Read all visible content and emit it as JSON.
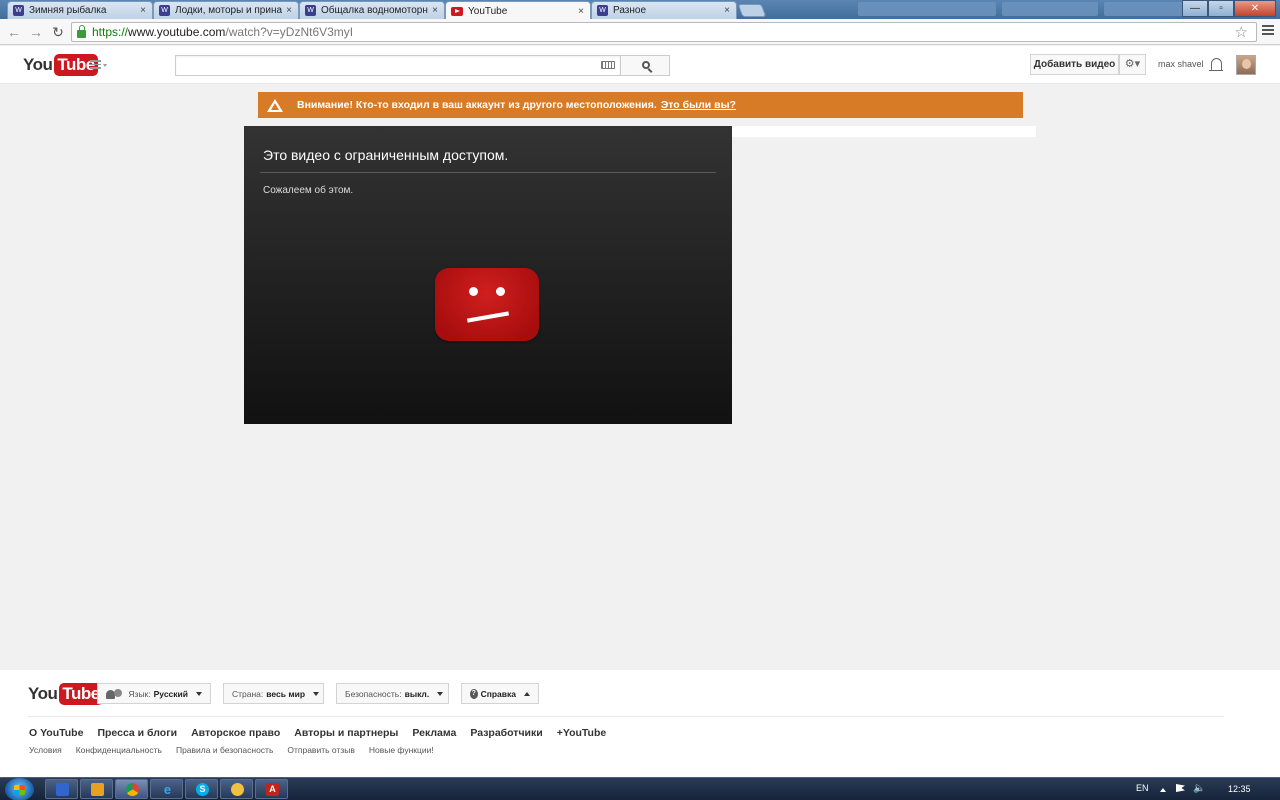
{
  "browser": {
    "tabs": [
      {
        "title": "Зимняя рыбалка",
        "favicon": "forum-icon",
        "active": false
      },
      {
        "title": "Лодки, моторы и принад",
        "favicon": "forum-icon",
        "active": false
      },
      {
        "title": "Общалка водномоторни",
        "favicon": "forum-icon",
        "active": false
      },
      {
        "title": "YouTube",
        "favicon": "youtube-icon",
        "active": true
      },
      {
        "title": "Разное",
        "favicon": "forum-icon",
        "active": false
      }
    ],
    "tab_close_glyph": "×",
    "url": {
      "scheme": "https://",
      "host": "www.youtube.com",
      "path": "/watch?v=yDzNt6V3myI"
    }
  },
  "masthead": {
    "logo_you": "You",
    "logo_tube": "Tube",
    "search_value": "",
    "upload_label": "Добавить видео",
    "settings_glyph": "⚙▾",
    "username": "max shavel"
  },
  "alert": {
    "message": "Внимание! Кто-то входил в ваш аккаунт из другого местоположения.",
    "link": "Это были вы?",
    "color": "#d77b26"
  },
  "player": {
    "title": "Это видео с ограниченным доступом.",
    "subtitle": "Сожалеем об этом.",
    "icon": "sad-youtube-icon",
    "icon_color": "#cc181e"
  },
  "footer": {
    "logo_you": "You",
    "logo_tube": "Tube",
    "language_label": "Язык:",
    "language_value": "Русский",
    "country_label": "Страна:",
    "country_value": "весь мир",
    "safety_label": "Безопасность:",
    "safety_value": "выкл.",
    "help_label": "Справка",
    "links_primary": [
      "О YouTube",
      "Пресса и блоги",
      "Авторское право",
      "Авторы и партнеры",
      "Реклама",
      "Разработчики",
      "+YouTube"
    ],
    "links_secondary": [
      "Условия",
      "Конфиденциальность",
      "Правила и безопасность",
      "Отправить отзыв",
      "Новые функции!"
    ]
  },
  "taskbar": {
    "language": "EN",
    "clock": "12:35"
  }
}
